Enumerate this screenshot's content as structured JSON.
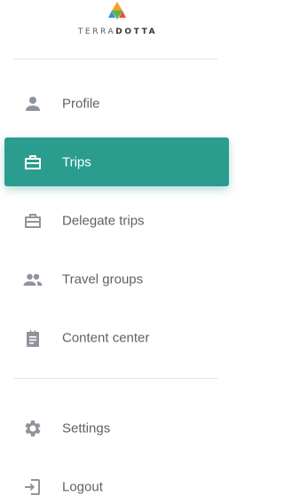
{
  "brand": {
    "name_prefix": "TERRA",
    "name_suffix": "DOTTA",
    "logo_icon": "terradotta-logo-icon"
  },
  "nav": {
    "items": [
      {
        "label": "Profile",
        "icon": "person-icon",
        "active": false
      },
      {
        "label": "Trips",
        "icon": "briefcase-icon",
        "active": true
      },
      {
        "label": "Delegate trips",
        "icon": "briefcase-icon",
        "active": false
      },
      {
        "label": "Travel groups",
        "icon": "people-icon",
        "active": false
      },
      {
        "label": "Content center",
        "icon": "clipboard-icon",
        "active": false
      }
    ],
    "secondary": [
      {
        "label": "Settings",
        "icon": "gear-icon",
        "active": false
      },
      {
        "label": "Logout",
        "icon": "logout-icon",
        "active": false
      }
    ]
  },
  "colors": {
    "accent": "#2a9d8f",
    "icon": "#8e949b",
    "text": "#5d6268",
    "divider": "#e3e3e3"
  }
}
